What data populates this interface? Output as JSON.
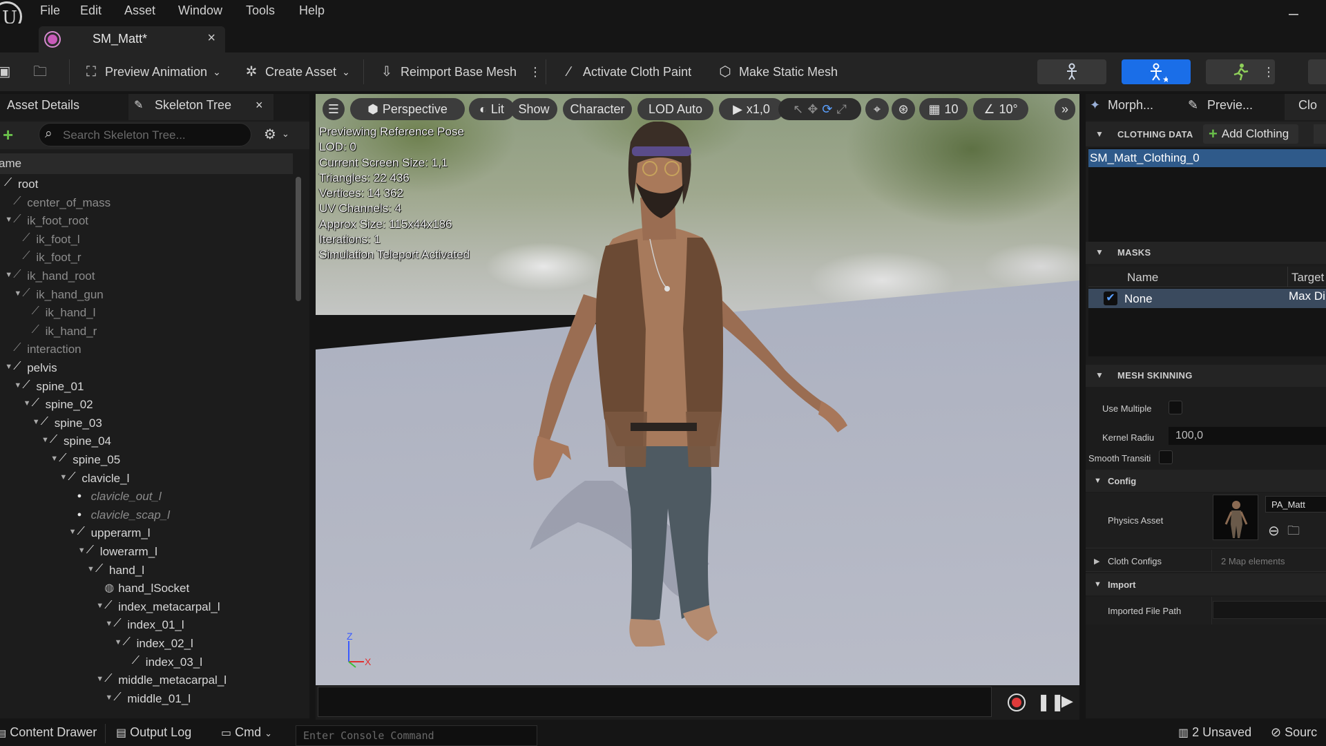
{
  "menu": [
    "File",
    "Edit",
    "Asset",
    "Window",
    "Tools",
    "Help"
  ],
  "tab": {
    "title": "SM_Matt*",
    "close": "×"
  },
  "toolbar": {
    "preview_animation": "Preview Animation",
    "create_asset": "Create Asset",
    "reimport": "Reimport Base Mesh",
    "cloth_paint": "Activate Cloth Paint",
    "static_mesh": "Make Static Mesh"
  },
  "left": {
    "tab_asset_details": "Asset Details",
    "tab_skeleton_tree": "Skeleton Tree",
    "tab_close": "×",
    "search_placeholder": "Search Skeleton Tree...",
    "column_name": "ame",
    "tree": [
      {
        "label": "root",
        "depth": 0,
        "arrow": false,
        "style": "normal"
      },
      {
        "label": "center_of_mass",
        "depth": 1,
        "arrow": false,
        "style": "dim"
      },
      {
        "label": "ik_foot_root",
        "depth": 1,
        "arrow": true,
        "style": "dim"
      },
      {
        "label": "ik_foot_l",
        "depth": 2,
        "arrow": false,
        "style": "dim"
      },
      {
        "label": "ik_foot_r",
        "depth": 2,
        "arrow": false,
        "style": "dim"
      },
      {
        "label": "ik_hand_root",
        "depth": 1,
        "arrow": true,
        "style": "dim"
      },
      {
        "label": "ik_hand_gun",
        "depth": 2,
        "arrow": true,
        "style": "dim"
      },
      {
        "label": "ik_hand_l",
        "depth": 3,
        "arrow": false,
        "style": "dim"
      },
      {
        "label": "ik_hand_r",
        "depth": 3,
        "arrow": false,
        "style": "dim"
      },
      {
        "label": "interaction",
        "depth": 1,
        "arrow": false,
        "style": "dim"
      },
      {
        "label": "pelvis",
        "depth": 1,
        "arrow": true,
        "style": "normal"
      },
      {
        "label": "spine_01",
        "depth": 2,
        "arrow": true,
        "style": "normal"
      },
      {
        "label": "spine_02",
        "depth": 3,
        "arrow": true,
        "style": "normal"
      },
      {
        "label": "spine_03",
        "depth": 4,
        "arrow": true,
        "style": "normal"
      },
      {
        "label": "spine_04",
        "depth": 5,
        "arrow": true,
        "style": "normal"
      },
      {
        "label": "spine_05",
        "depth": 6,
        "arrow": true,
        "style": "normal"
      },
      {
        "label": "clavicle_l",
        "depth": 7,
        "arrow": true,
        "style": "normal"
      },
      {
        "label": "clavicle_out_l",
        "depth": 8,
        "arrow": false,
        "style": "italic"
      },
      {
        "label": "clavicle_scap_l",
        "depth": 8,
        "arrow": false,
        "style": "italic"
      },
      {
        "label": "upperarm_l",
        "depth": 8,
        "arrow": true,
        "style": "normal"
      },
      {
        "label": "lowerarm_l",
        "depth": 9,
        "arrow": true,
        "style": "normal"
      },
      {
        "label": "hand_l",
        "depth": 10,
        "arrow": true,
        "style": "normal"
      },
      {
        "label": "hand_lSocket",
        "depth": 11,
        "arrow": false,
        "style": "socket"
      },
      {
        "label": "index_metacarpal_l",
        "depth": 11,
        "arrow": true,
        "style": "normal"
      },
      {
        "label": "index_01_l",
        "depth": 12,
        "arrow": true,
        "style": "normal"
      },
      {
        "label": "index_02_l",
        "depth": 13,
        "arrow": true,
        "style": "normal"
      },
      {
        "label": "index_03_l",
        "depth": 14,
        "arrow": false,
        "style": "normal"
      },
      {
        "label": "middle_metacarpal_l",
        "depth": 11,
        "arrow": true,
        "style": "normal"
      },
      {
        "label": "middle_01_l",
        "depth": 12,
        "arrow": true,
        "style": "normal"
      }
    ]
  },
  "viewport": {
    "perspective": "Perspective",
    "lit": "Lit",
    "show": "Show",
    "character": "Character",
    "lod": "LOD Auto",
    "speed": "x1,0",
    "grid": "10",
    "angle": "10°",
    "stats": [
      "Previewing Reference Pose",
      "LOD: 0",
      "Current Screen Size: 1,1",
      "Triangles: 22 436",
      "Vertices: 14 362",
      "UV Channels: 4",
      "Approx Size: 115x44x186",
      "Iterations: 1",
      "Simulation Teleport Activated"
    ],
    "axis_z": "Z",
    "axis_x": "X"
  },
  "right": {
    "tab_morph": "Morph...",
    "tab_preview": "Previe...",
    "tab_clo": "Clo",
    "clothing_data": "CLOTHING DATA",
    "add_clothing": "Add Clothing",
    "clothing_item": "SM_Matt_Clothing_0",
    "masks": "MASKS",
    "mask_col_name": "Name",
    "mask_col_target": "Target",
    "mask_row_name": "None",
    "mask_row_target": "Max Di",
    "mesh_skinning": "MESH SKINNING",
    "use_multiple": "Use Multiple",
    "kernel_radius": "Kernel Radiu",
    "kernel_value": "100,0",
    "smooth_transition": "Smooth Transiti",
    "config": "Config",
    "physics_asset": "Physics Asset",
    "physics_asset_value": "PA_Matt",
    "cloth_configs": "Cloth Configs",
    "cloth_configs_value": "2 Map elements",
    "import": "Import",
    "imported_file_path": "Imported File Path"
  },
  "status": {
    "content_drawer": "Content Drawer",
    "output_log": "Output Log",
    "cmd": "Cmd",
    "console_placeholder": "Enter Console Command",
    "unsaved": "2 Unsaved",
    "source": "Sourc"
  },
  "colors": {
    "accent": "#1a6ee8",
    "panel": "#1c1c1c",
    "selection": "#2f5a8a"
  }
}
